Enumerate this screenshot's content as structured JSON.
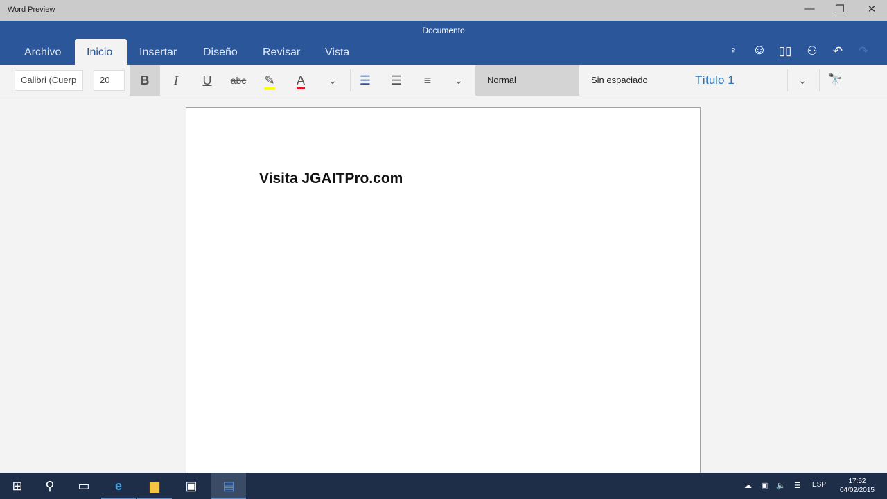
{
  "window": {
    "app_title": "Word Preview",
    "doc_title": "Documento",
    "minimize": "—",
    "restore": "❐",
    "close": "✕"
  },
  "tabs": [
    {
      "label": "Archivo"
    },
    {
      "label": "Inicio"
    },
    {
      "label": "Insertar"
    },
    {
      "label": "Diseño"
    },
    {
      "label": "Revisar"
    },
    {
      "label": "Vista"
    }
  ],
  "active_tab": "Inicio",
  "ribbon_icons": {
    "lightbulb": "💡",
    "smiley": "☺",
    "book": "📖",
    "share": "👤",
    "undo": "↶",
    "redo": "↷"
  },
  "toolbar": {
    "font": "Calibri (Cuerp",
    "size": "20",
    "bold": "B",
    "italic": "I",
    "underline": "U",
    "strike": "abc",
    "more": "⌄",
    "styles": [
      "Normal",
      "Sin espaciado",
      "Título 1"
    ],
    "find": "🔭"
  },
  "document": {
    "text": "Visita JGAITPro.com"
  },
  "taskbar": {
    "lang": "ESP",
    "time": "17:52",
    "date": "04/02/2015"
  },
  "colors": {
    "ribbon": "#2b579a",
    "taskbar": "#1e2e48",
    "highlight": "#ffff00",
    "font_color": "#e81123",
    "heading": "#2e74b5"
  }
}
